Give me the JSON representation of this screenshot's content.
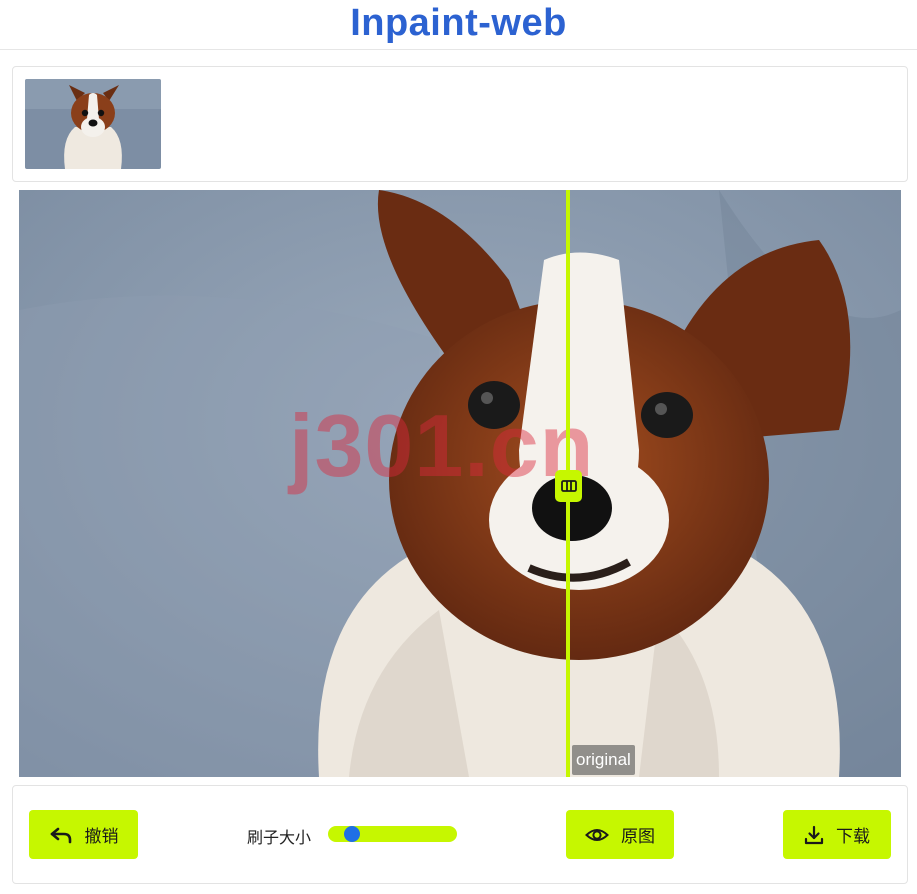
{
  "app": {
    "title": "Inpaint-web"
  },
  "gallery": {
    "thumbnails": [
      {
        "icon": "papillon-dog-thumbnail"
      }
    ]
  },
  "editor": {
    "compare_label": "original",
    "watermark": "j301.cn",
    "divider_position": 0.622,
    "divider_color": "#c6f700"
  },
  "toolbar": {
    "undo_label": "撤销",
    "brush_size_label": "刷子大小",
    "brush_size_value": 0.14,
    "original_label": "原图",
    "download_label": "下载"
  },
  "colors": {
    "accent": "#c6f700",
    "title": "#2c62d1",
    "slider_knob": "#1f6fe5"
  }
}
